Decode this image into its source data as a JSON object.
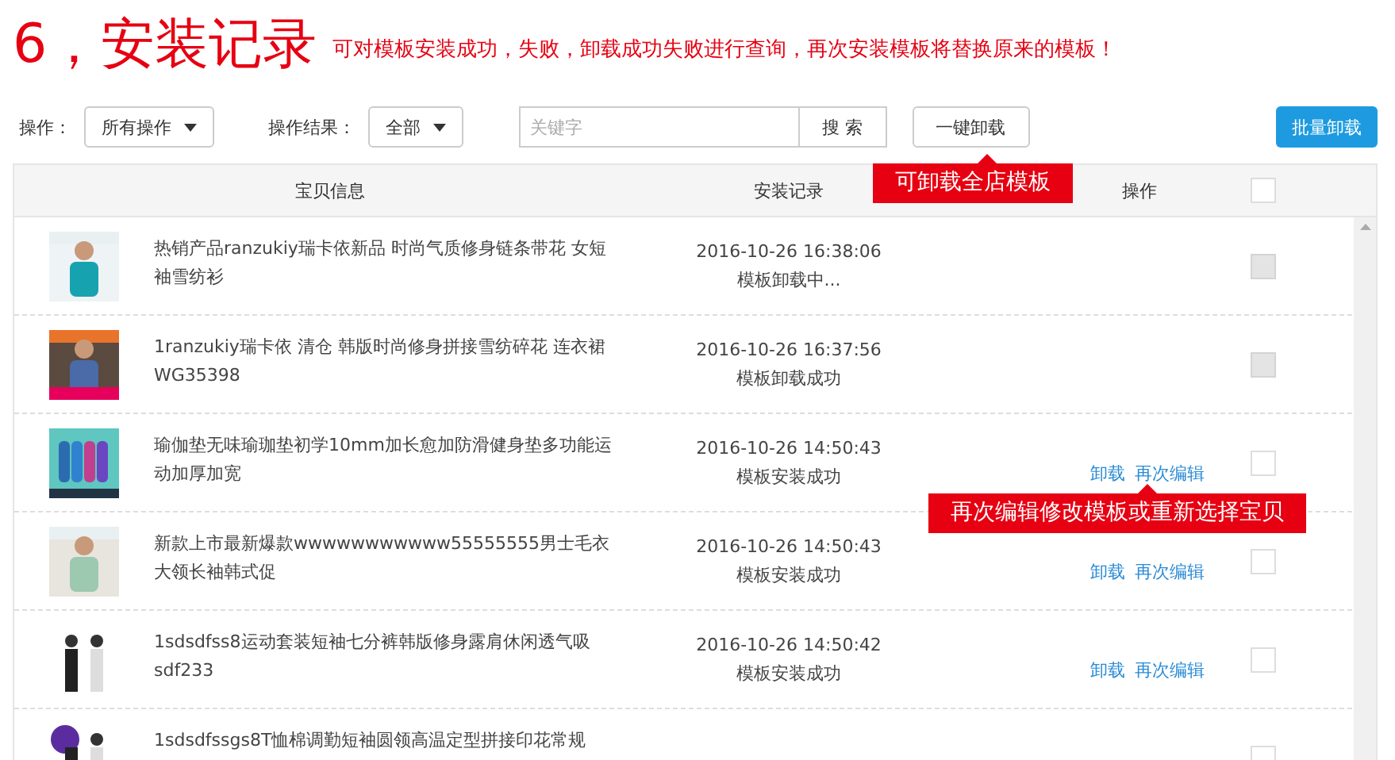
{
  "heading": {
    "title": "6，安装记录",
    "note": "可对模板安装成功，失败，卸载成功失败进行查询，再次安装模板将替换原来的模板！"
  },
  "toolbar": {
    "operation_label": "操作：",
    "operation_value": "所有操作",
    "result_label": "操作结果：",
    "result_value": "全部",
    "search_placeholder": "关键字",
    "search_button": "搜 索",
    "uninstall_all_button": "一键卸载",
    "batch_button": "批量卸载"
  },
  "table": {
    "columns": [
      "宝贝信息",
      "安装记录",
      "操作"
    ],
    "header_checked": false,
    "rows": [
      {
        "title": "热销产品ranzukiy瑞卡依新品 时尚气质修身链条带花 女短袖雪纺衫",
        "time": "2016-10-26 16:38:06",
        "status": "模板卸载中...",
        "actions": [],
        "disabled": true
      },
      {
        "title": "1ranzukiy瑞卡依 清仓 韩版时尚修身拼接雪纺碎花 连衣裙WG35398",
        "time": "2016-10-26 16:37:56",
        "status": "模板卸载成功",
        "actions": [],
        "disabled": true
      },
      {
        "title": "瑜伽垫无味瑜珈垫初学10mm加长愈加防滑健身垫多功能运动加厚加宽",
        "time": "2016-10-26 14:50:43",
        "status": "模板安装成功",
        "actions": [
          "卸载",
          "再次编辑"
        ],
        "disabled": false
      },
      {
        "title": "新款上市最新爆款wwwwwwwwwww55555555男士毛衣大领长袖韩式促",
        "time": "2016-10-26 14:50:43",
        "status": "模板安装成功",
        "actions": [
          "卸载",
          "再次编辑"
        ],
        "disabled": false
      },
      {
        "title": "1sdsdfss8运动套装短袖七分裤韩版修身露肩休闲透气吸sdf233",
        "time": "2016-10-26 14:50:42",
        "status": "模板安装成功",
        "actions": [
          "卸载",
          "再次编辑"
        ],
        "disabled": false
      },
      {
        "title": "1sdsdfssgs8T恤棉调勤短袖圆领高温定型拼接印花常规",
        "actions": [],
        "disabled": false
      }
    ]
  },
  "callouts": [
    {
      "text": "可卸载全店模板"
    },
    {
      "text": "再次编辑修改模板或重新选择宝贝"
    }
  ]
}
